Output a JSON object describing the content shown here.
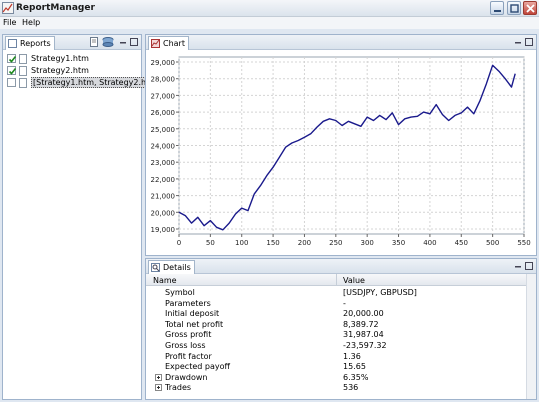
{
  "window": {
    "title": "ReportManager"
  },
  "menu": {
    "file": "File",
    "help": "Help"
  },
  "reports_panel": {
    "tab_label": "Reports",
    "items": [
      {
        "label": "Strategy1.htm",
        "checked": true
      },
      {
        "label": "Strategy2.htm",
        "checked": true
      },
      {
        "label": "[Strategy1.htm, Strategy2.htm]",
        "checked": false,
        "selected": true
      }
    ]
  },
  "chart_panel": {
    "tab_label": "Chart"
  },
  "chart_data": {
    "type": "line",
    "x_ticks": [
      "0",
      "50",
      "100",
      "150",
      "200",
      "250",
      "300",
      "350",
      "400",
      "450",
      "500",
      "550"
    ],
    "y_ticks": [
      "19,000",
      "20,000",
      "21,000",
      "22,000",
      "23,000",
      "24,000",
      "25,000",
      "26,000",
      "27,000",
      "28,000",
      "29,000"
    ],
    "xlim": [
      0,
      550
    ],
    "ylim": [
      18700,
      29300
    ],
    "line_color": "#1a1a8c",
    "series": [
      {
        "x": [
          0,
          10,
          20,
          30,
          40,
          50,
          60,
          70,
          80,
          90,
          100,
          110,
          120,
          130,
          140,
          150,
          160,
          170,
          180,
          190,
          200,
          210,
          220,
          230,
          240,
          250,
          260,
          270,
          280,
          290,
          300,
          310,
          320,
          330,
          340,
          350,
          360,
          370,
          380,
          390,
          400,
          410,
          420,
          430,
          440,
          450,
          460,
          470,
          480,
          490,
          500,
          510,
          520,
          530,
          536
        ],
        "y": [
          20000,
          19800,
          19350,
          19700,
          19200,
          19500,
          19100,
          18950,
          19350,
          19900,
          20250,
          20100,
          21100,
          21600,
          22200,
          22700,
          23300,
          23900,
          24150,
          24300,
          24500,
          24700,
          25100,
          25450,
          25600,
          25500,
          25200,
          25450,
          25300,
          25150,
          25700,
          25500,
          25800,
          25550,
          25950,
          25250,
          25600,
          25700,
          25750,
          26000,
          25900,
          26450,
          25850,
          25500,
          25800,
          25950,
          26300,
          25900,
          26700,
          27700,
          28800,
          28450,
          28000,
          27500,
          28300
        ]
      }
    ]
  },
  "details_panel": {
    "tab_label": "Details",
    "columns": {
      "name": "Name",
      "value": "Value"
    },
    "rows": [
      {
        "name": "Symbol",
        "value": "[USDJPY, GBPUSD]",
        "expandable": false
      },
      {
        "name": "Parameters",
        "value": "-",
        "expandable": false
      },
      {
        "name": "Initial deposit",
        "value": "20,000.00",
        "expandable": false
      },
      {
        "name": "Total net profit",
        "value": "8,389.72",
        "expandable": false
      },
      {
        "name": "Gross profit",
        "value": "31,987.04",
        "expandable": false
      },
      {
        "name": "Gross loss",
        "value": "-23,597.32",
        "expandable": false
      },
      {
        "name": "Profit factor",
        "value": "1.36",
        "expandable": false
      },
      {
        "name": "Expected payoff",
        "value": "15.65",
        "expandable": false
      },
      {
        "name": "Drawdown",
        "value": "6.35%",
        "expandable": true
      },
      {
        "name": "Trades",
        "value": "536",
        "expandable": true
      }
    ]
  }
}
